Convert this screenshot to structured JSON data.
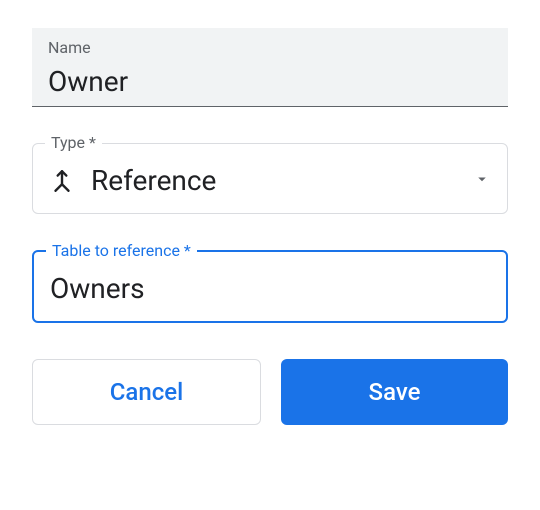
{
  "name_field": {
    "label": "Name",
    "value": "Owner"
  },
  "type_field": {
    "label": "Type *",
    "value": "Reference",
    "icon": "merge-icon"
  },
  "table_field": {
    "label": "Table to reference *",
    "value": "Owners"
  },
  "buttons": {
    "cancel": "Cancel",
    "save": "Save"
  }
}
